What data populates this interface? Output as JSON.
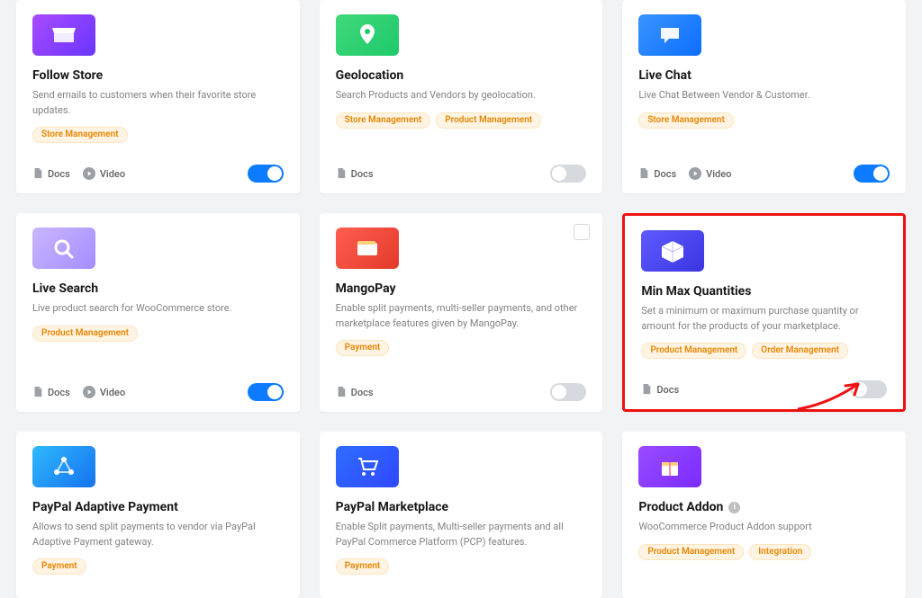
{
  "labels": {
    "docs": "Docs",
    "video": "Video"
  },
  "cards": [
    {
      "id": "follow-store",
      "title": "Follow Store",
      "desc": "Send emails to customers when their favorite store updates.",
      "tags": [
        "Store Management"
      ],
      "thumb": {
        "bg": "bg-purple-grad",
        "icon": "store-icon"
      },
      "links": {
        "docs": true,
        "video": true
      },
      "enabled": true
    },
    {
      "id": "geolocation",
      "title": "Geolocation",
      "desc": "Search Products and Vendors by geolocation.",
      "tags": [
        "Store Management",
        "Product Management"
      ],
      "thumb": {
        "bg": "bg-green",
        "icon": "map-pin-icon"
      },
      "links": {
        "docs": true,
        "video": false
      },
      "enabled": false
    },
    {
      "id": "live-chat",
      "title": "Live Chat",
      "desc": "Live Chat Between Vendor & Customer.",
      "tags": [
        "Store Management"
      ],
      "thumb": {
        "bg": "bg-blue",
        "icon": "chat-icon"
      },
      "links": {
        "docs": true,
        "video": true
      },
      "enabled": true
    },
    {
      "id": "live-search",
      "title": "Live Search",
      "desc": "Live product search for WooCommerce store.",
      "tags": [
        "Product Management"
      ],
      "thumb": {
        "bg": "bg-lav",
        "icon": "search-icon"
      },
      "links": {
        "docs": true,
        "video": true
      },
      "enabled": true
    },
    {
      "id": "mangopay",
      "title": "MangoPay",
      "desc": "Enable split payments, multi-seller payments, and other marketplace features given by MangoPay.",
      "tags": [
        "Payment"
      ],
      "thumb": {
        "bg": "bg-red",
        "icon": "wallet-icon"
      },
      "links": {
        "docs": true,
        "video": false
      },
      "enabled": false,
      "checkbox": true
    },
    {
      "id": "min-max",
      "title": "Min Max Quantities",
      "desc": "Set a minimum or maximum purchase quantity or amount for the products of your marketplace.",
      "tags": [
        "Product Management",
        "Order Management"
      ],
      "thumb": {
        "bg": "bg-indigo",
        "icon": "box-icon"
      },
      "links": {
        "docs": true,
        "video": false
      },
      "enabled": false,
      "highlight": true
    },
    {
      "id": "paypal-adaptive",
      "title": "PayPal Adaptive Payment",
      "desc": "Allows to send split payments to vendor via PayPal Adaptive Payment gateway.",
      "tags": [
        "Payment"
      ],
      "thumb": {
        "bg": "bg-cyan",
        "icon": "nodes-icon"
      },
      "links": {
        "docs": false,
        "video": false
      }
    },
    {
      "id": "paypal-marketplace",
      "title": "PayPal Marketplace",
      "desc": "Enable Split payments, Multi-seller payments and all PayPal Commerce Platform (PCP) features.",
      "tags": [
        "Payment"
      ],
      "thumb": {
        "bg": "bg-deepblue",
        "icon": "cart-icon"
      },
      "links": {
        "docs": false,
        "video": false
      }
    },
    {
      "id": "product-addon",
      "title": "Product Addon",
      "desc": "WooCommerce Product Addon support",
      "tags": [
        "Product Management",
        "Integration"
      ],
      "thumb": {
        "bg": "bg-violet",
        "icon": "gift-icon"
      },
      "links": {
        "docs": false,
        "video": false
      },
      "info": true
    }
  ]
}
